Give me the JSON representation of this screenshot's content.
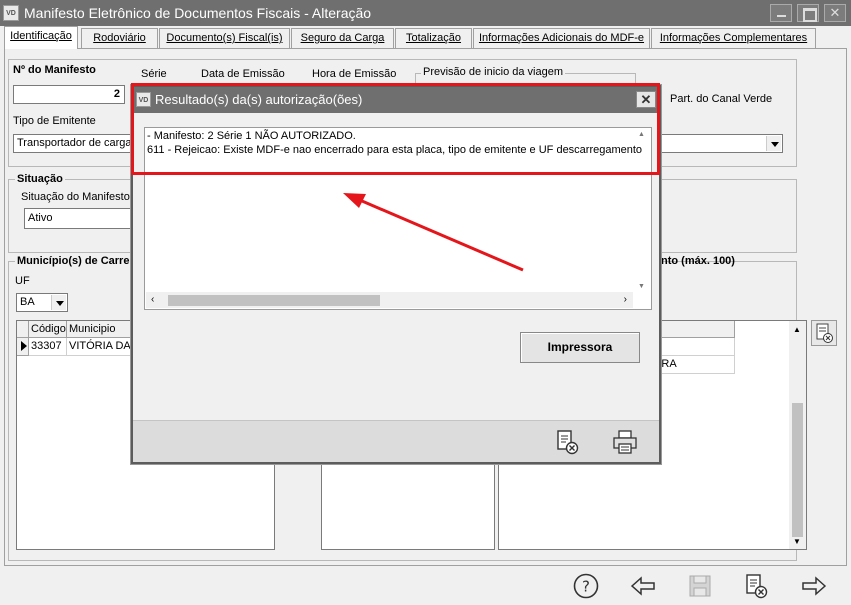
{
  "window": {
    "app_icon": "VD",
    "title": "Manifesto Eletrônico de Documentos Fiscais - Alteração"
  },
  "tabs": [
    {
      "label": "Identificação"
    },
    {
      "label": "Rodoviário"
    },
    {
      "label": "Documento(s) Fiscal(is)"
    },
    {
      "label": "Seguro da Carga"
    },
    {
      "label": "Totalização"
    },
    {
      "label": "Informações Adicionais do MDF-e"
    },
    {
      "label": "Informações Complementares"
    }
  ],
  "form": {
    "manifesto_label": "Nº do Manifesto",
    "manifesto_value": "2",
    "serie_label": "Série",
    "data_emissao_label": "Data de Emissão",
    "hora_emissao_label": "Hora de Emissão",
    "previsao_label": "Previsão de inicio da viagem",
    "canal_verde_label": "Part. do Canal Verde",
    "tipo_emitente_label": "Tipo de Emitente",
    "tipo_emitente_value": "Transportador de carga",
    "situacao_group": "Situação",
    "situacao_label": "Situação do Manifesto",
    "situacao_value": "Ativo",
    "municipios_carregamento": "Município(s) de Carregamento",
    "municipios_descarregamento_suffix": "nto (máx. 100)",
    "uf_label": "UF",
    "uf_value": "BA",
    "grid_headers": [
      "Código",
      "Municipio"
    ],
    "grid_row": {
      "codigo": "33307",
      "municipio": "VITÓRIA DA CONQUISTA"
    },
    "right_grid_value": "EIRA"
  },
  "modal": {
    "icon": "VD",
    "title": "Resultado(s) da(s) autorização(ões)",
    "lines": [
      "- Manifesto: 2 Série 1 NÃO AUTORIZADO.",
      "611 - Rejeicao: Existe MDF-e nao encerrado para esta placa, tipo de emitente e UF descarregamento"
    ],
    "print_button": "Impressora",
    "footer_icons": [
      "cancel-document-icon",
      "printer-icon"
    ]
  },
  "toolbar_icons": [
    "help-icon",
    "back-arrow-icon",
    "save-icon",
    "cancel-document-icon",
    "forward-arrow-icon"
  ],
  "colors": {
    "titlebar": "#6f6f6f",
    "highlight": "#e5161b"
  }
}
